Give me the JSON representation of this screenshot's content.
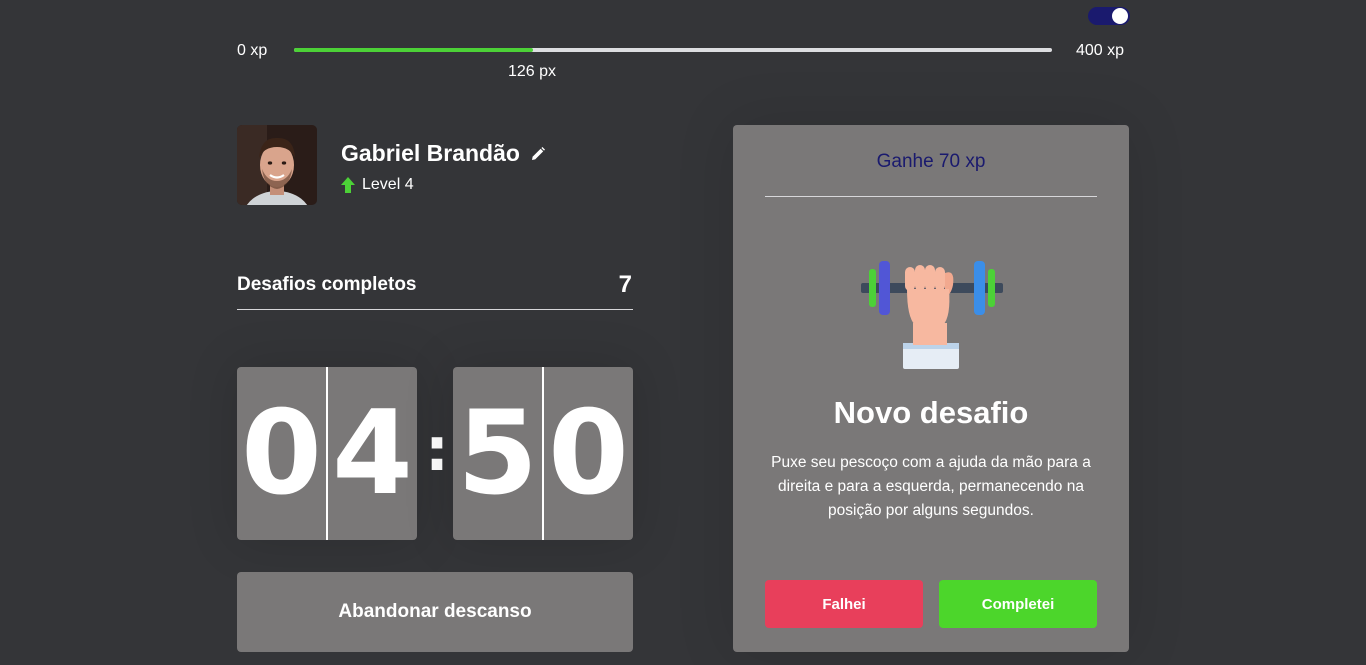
{
  "theme_toggle": {
    "state": "on"
  },
  "xp_bar": {
    "min_label": "0 xp",
    "max_label": "400 xp",
    "current_label": "126 px",
    "progress_fraction": 0.315
  },
  "profile": {
    "name": "Gabriel Brandão",
    "level_label": "Level 4"
  },
  "completed": {
    "label": "Desafios completos",
    "value": "7"
  },
  "countdown": {
    "minutes_left": "0",
    "minutes_right": "4",
    "separator": ":",
    "seconds_left": "5",
    "seconds_right": "0"
  },
  "rest_button": {
    "label": "Abandonar descanso"
  },
  "challenge": {
    "header": "Ganhe 70 xp",
    "icon": "dumbbell-hand-icon",
    "title": "Novo desafio",
    "description": "Puxe seu pescoço com a ajuda da mão para a direita e para a esquerda, permanecendo na posição por alguns segundos.",
    "fail_label": "Falhei",
    "success_label": "Completei"
  },
  "colors": {
    "background": "#343538",
    "card": "#7a7878",
    "accent_green": "#4cd137",
    "fail_red": "#e83f5b",
    "header_blue": "#1a1a6e"
  }
}
